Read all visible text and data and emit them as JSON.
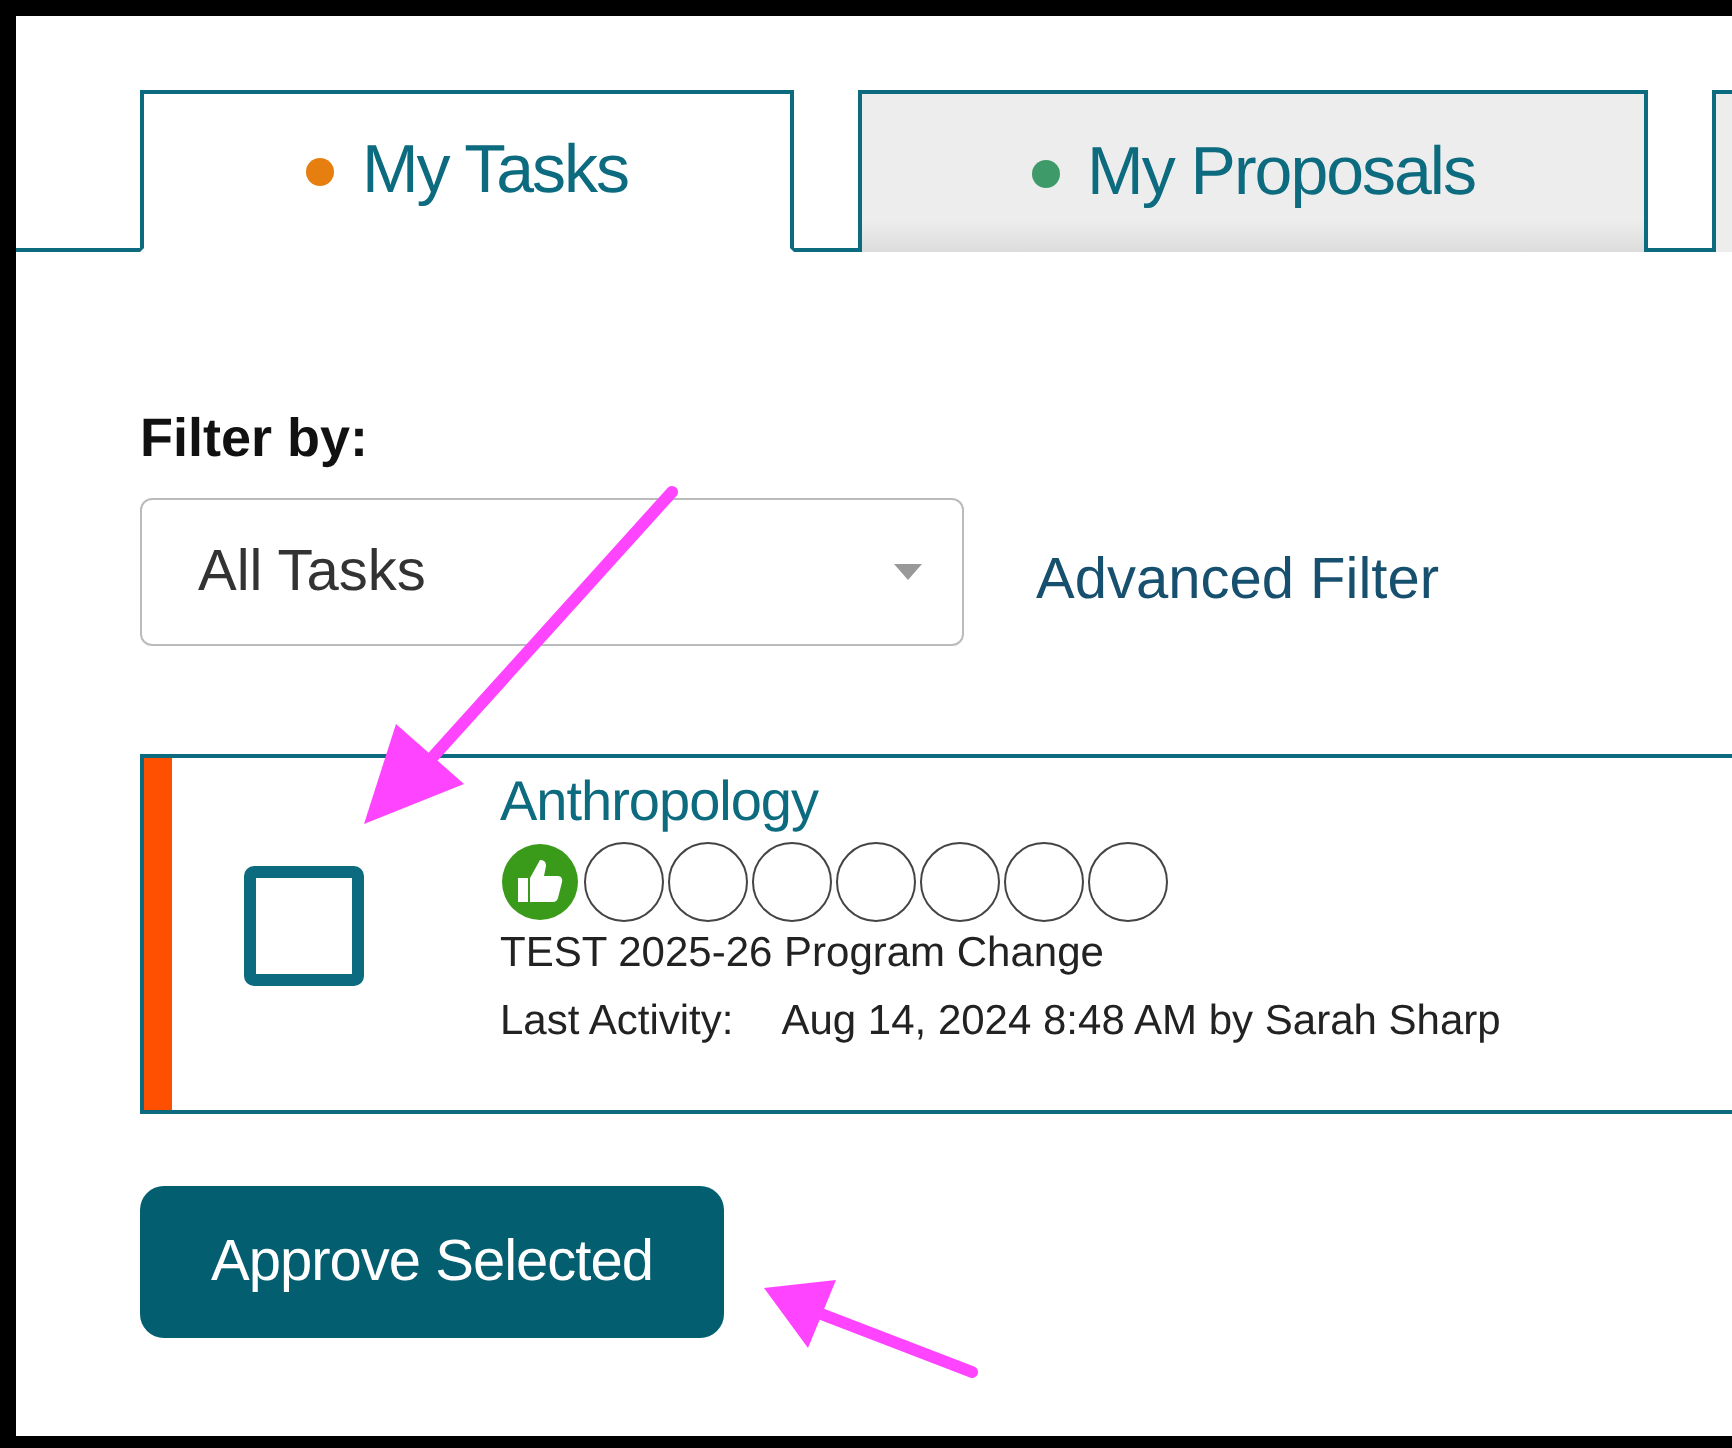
{
  "tabs": [
    {
      "label": "My Tasks",
      "selected": true,
      "color": "#e67e10"
    },
    {
      "label": "My Proposals",
      "selected": false,
      "color": "#3f9a6a"
    }
  ],
  "filter": {
    "label": "Filter by:",
    "select": {
      "value": "All Tasks"
    },
    "link": "Advanced Filter"
  },
  "tasks": [
    {
      "title": "Anthropology",
      "checked": false,
      "color": "#ff4f00",
      "steps": [
        {
          "kind": "approved"
        },
        {
          "kind": "pending"
        },
        {
          "kind": "pending"
        },
        {
          "kind": "pending"
        },
        {
          "kind": "pending"
        },
        {
          "kind": "pending"
        },
        {
          "kind": "pending"
        },
        {
          "kind": "pending"
        }
      ],
      "subtitle": "TEST 2025-26 Program Change",
      "activity_label": "Last Activity:",
      "activity": "Aug 14, 2024 8:48 AM by Sarah Sharp"
    }
  ],
  "button": "Approve Selected"
}
